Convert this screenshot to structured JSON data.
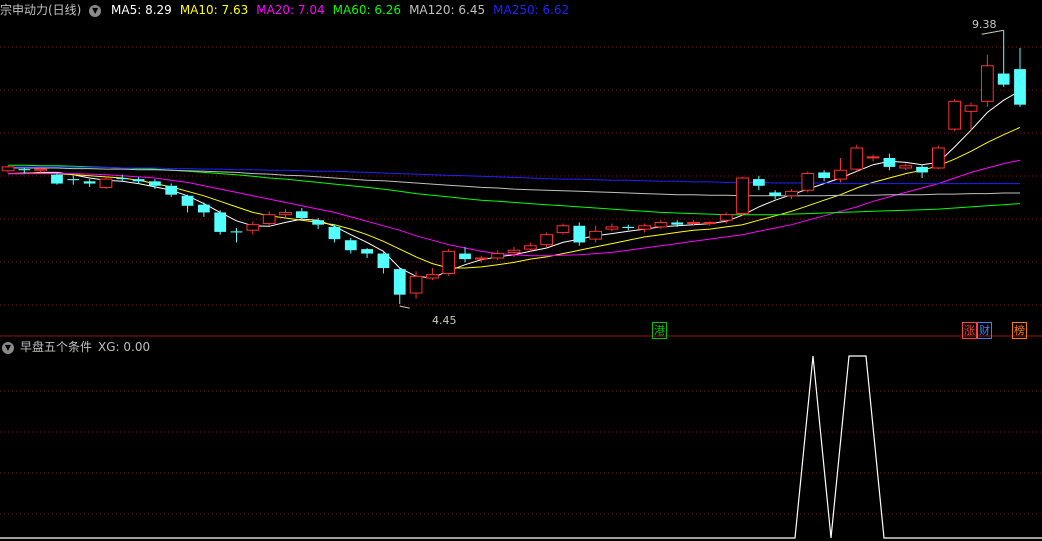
{
  "main_header": {
    "title": "宗申动力(日线)",
    "ma": [
      {
        "label": "MA5: ",
        "value": "8.29",
        "color": "#ffffff"
      },
      {
        "label": "MA10: ",
        "value": "7.63",
        "color": "#ffff00"
      },
      {
        "label": "MA20: ",
        "value": "7.04",
        "color": "#ff00ff"
      },
      {
        "label": "MA60: ",
        "value": "6.26",
        "color": "#00ff00"
      },
      {
        "label": "MA120: ",
        "value": "6.45",
        "color": "#c0c0c0"
      },
      {
        "label": "MA250: ",
        "value": "6.62",
        "color": "#2020ff"
      }
    ]
  },
  "sub_header": {
    "title": "早盘五个条件",
    "xg_label": "XG: ",
    "xg_value": "0.00"
  },
  "annotations": {
    "high": "9.38",
    "low": "4.45"
  },
  "tags": [
    {
      "text": "港",
      "color": "#00c000"
    },
    {
      "text": "涨",
      "color": "#ff4040"
    },
    {
      "text": "财",
      "color": "#4080ff"
    },
    {
      "text": "榜",
      "color": "#ff8000"
    }
  ],
  "chart_data": {
    "type": "candlestick",
    "ylim": [
      4.2,
      9.6
    ],
    "up_color": "#ff3030",
    "down_color": "#54ffff",
    "candles": [
      [
        6.85,
        6.92,
        6.94,
        6.82
      ],
      [
        6.88,
        6.86,
        6.9,
        6.8
      ],
      [
        6.86,
        6.88,
        6.9,
        6.82
      ],
      [
        6.78,
        6.62,
        6.8,
        6.6
      ],
      [
        6.7,
        6.68,
        6.76,
        6.6
      ],
      [
        6.66,
        6.62,
        6.7,
        6.56
      ],
      [
        6.55,
        6.7,
        6.74,
        6.52
      ],
      [
        6.72,
        6.7,
        6.78,
        6.66
      ],
      [
        6.7,
        6.66,
        6.74,
        6.62
      ],
      [
        6.66,
        6.58,
        6.7,
        6.52
      ],
      [
        6.58,
        6.42,
        6.62,
        6.38
      ],
      [
        6.4,
        6.22,
        6.42,
        6.1
      ],
      [
        6.24,
        6.1,
        6.28,
        6.02
      ],
      [
        6.1,
        5.75,
        6.14,
        5.7
      ],
      [
        5.76,
        5.74,
        5.82,
        5.56
      ],
      [
        5.78,
        5.88,
        5.94,
        5.7
      ],
      [
        5.9,
        6.06,
        6.12,
        5.86
      ],
      [
        6.06,
        6.1,
        6.16,
        6.0
      ],
      [
        6.12,
        6.0,
        6.18,
        5.96
      ],
      [
        5.96,
        5.88,
        6.0,
        5.8
      ],
      [
        5.84,
        5.62,
        5.88,
        5.56
      ],
      [
        5.6,
        5.42,
        5.64,
        5.36
      ],
      [
        5.44,
        5.36,
        5.46,
        5.28
      ],
      [
        5.36,
        5.1,
        5.38,
        5.0
      ],
      [
        5.08,
        4.62,
        5.1,
        4.45
      ],
      [
        4.65,
        4.95,
        5.04,
        4.55
      ],
      [
        4.92,
        4.98,
        5.1,
        4.88
      ],
      [
        5.0,
        5.4,
        5.44,
        4.96
      ],
      [
        5.36,
        5.26,
        5.48,
        5.2
      ],
      [
        5.26,
        5.28,
        5.32,
        5.2
      ],
      [
        5.28,
        5.36,
        5.42,
        5.24
      ],
      [
        5.38,
        5.42,
        5.48,
        5.3
      ],
      [
        5.44,
        5.5,
        5.56,
        5.4
      ],
      [
        5.52,
        5.7,
        5.74,
        5.48
      ],
      [
        5.74,
        5.86,
        5.9,
        5.7
      ],
      [
        5.86,
        5.56,
        5.92,
        5.5
      ],
      [
        5.62,
        5.76,
        5.86,
        5.56
      ],
      [
        5.8,
        5.84,
        5.9,
        5.76
      ],
      [
        5.84,
        5.82,
        5.88,
        5.78
      ],
      [
        5.8,
        5.86,
        5.9,
        5.74
      ],
      [
        5.84,
        5.92,
        5.96,
        5.8
      ],
      [
        5.92,
        5.88,
        5.96,
        5.84
      ],
      [
        5.9,
        5.92,
        5.96,
        5.86
      ],
      [
        5.9,
        5.92,
        5.94,
        5.86
      ],
      [
        5.96,
        6.06,
        6.1,
        5.9
      ],
      [
        6.08,
        6.72,
        6.74,
        6.04
      ],
      [
        6.7,
        6.58,
        6.76,
        6.5
      ],
      [
        6.46,
        6.4,
        6.5,
        6.34
      ],
      [
        6.4,
        6.48,
        6.52,
        6.34
      ],
      [
        6.5,
        6.8,
        6.84,
        6.46
      ],
      [
        6.82,
        6.72,
        6.86,
        6.66
      ],
      [
        6.7,
        6.86,
        7.08,
        6.64
      ],
      [
        6.88,
        7.26,
        7.32,
        6.84
      ],
      [
        7.1,
        7.1,
        7.14,
        7.02
      ],
      [
        7.08,
        6.92,
        7.16,
        6.86
      ],
      [
        6.9,
        6.94,
        6.98,
        6.86
      ],
      [
        6.92,
        6.82,
        6.96,
        6.72
      ],
      [
        6.9,
        7.26,
        7.3,
        6.88
      ],
      [
        7.6,
        8.1,
        8.14,
        7.56
      ],
      [
        7.92,
        8.02,
        8.08,
        7.58
      ],
      [
        8.1,
        8.74,
        8.94,
        8.0
      ],
      [
        8.6,
        8.4,
        9.38,
        8.36
      ],
      [
        8.68,
        8.04,
        9.06,
        8.0
      ]
    ],
    "ma_series": [
      {
        "name": "MA5",
        "color": "#ffffff",
        "values": [
          6.8,
          6.8,
          6.82,
          6.82,
          6.78,
          6.72,
          6.68,
          6.66,
          6.62,
          6.56,
          6.5,
          6.4,
          6.26,
          6.1,
          5.95,
          5.86,
          5.85,
          5.92,
          5.98,
          5.96,
          5.85,
          5.7,
          5.56,
          5.4,
          5.1,
          4.95,
          4.92,
          5.05,
          5.16,
          5.25,
          5.3,
          5.34,
          5.4,
          5.46,
          5.56,
          5.62,
          5.68,
          5.72,
          5.76,
          5.8,
          5.84,
          5.86,
          5.88,
          5.9,
          5.94,
          6.05,
          6.2,
          6.32,
          6.42,
          6.52,
          6.62,
          6.72,
          6.84,
          6.96,
          7.02,
          7.0,
          6.96,
          7.0,
          7.28,
          7.58,
          7.9,
          8.12,
          8.29
        ]
      },
      {
        "name": "MA10",
        "color": "#ffff00",
        "values": [
          6.8,
          6.81,
          6.81,
          6.8,
          6.78,
          6.76,
          6.74,
          6.72,
          6.68,
          6.62,
          6.56,
          6.48,
          6.4,
          6.3,
          6.2,
          6.1,
          6.04,
          6.0,
          5.96,
          5.92,
          5.88,
          5.8,
          5.7,
          5.58,
          5.44,
          5.3,
          5.18,
          5.1,
          5.1,
          5.12,
          5.16,
          5.2,
          5.26,
          5.3,
          5.36,
          5.42,
          5.48,
          5.54,
          5.6,
          5.66,
          5.7,
          5.74,
          5.78,
          5.8,
          5.84,
          5.88,
          5.96,
          6.04,
          6.12,
          6.22,
          6.32,
          6.42,
          6.54,
          6.64,
          6.72,
          6.8,
          6.86,
          6.94,
          7.06,
          7.2,
          7.36,
          7.5,
          7.63
        ]
      },
      {
        "name": "MA20",
        "color": "#ff00ff",
        "values": [
          6.8,
          6.8,
          6.8,
          6.8,
          6.8,
          6.79,
          6.78,
          6.76,
          6.74,
          6.72,
          6.68,
          6.64,
          6.58,
          6.52,
          6.46,
          6.4,
          6.34,
          6.28,
          6.22,
          6.16,
          6.1,
          6.02,
          5.94,
          5.86,
          5.78,
          5.68,
          5.6,
          5.52,
          5.46,
          5.4,
          5.36,
          5.34,
          5.32,
          5.32,
          5.33,
          5.34,
          5.36,
          5.38,
          5.42,
          5.46,
          5.5,
          5.54,
          5.58,
          5.62,
          5.66,
          5.7,
          5.76,
          5.82,
          5.88,
          5.96,
          6.04,
          6.12,
          6.2,
          6.3,
          6.38,
          6.46,
          6.54,
          6.62,
          6.72,
          6.82,
          6.9,
          6.98,
          7.04
        ]
      },
      {
        "name": "MA60",
        "color": "#00ff00",
        "values": [
          6.95,
          6.95,
          6.94,
          6.94,
          6.93,
          6.92,
          6.91,
          6.9,
          6.89,
          6.88,
          6.86,
          6.84,
          6.82,
          6.8,
          6.78,
          6.75,
          6.72,
          6.7,
          6.67,
          6.64,
          6.61,
          6.58,
          6.55,
          6.52,
          6.48,
          6.44,
          6.41,
          6.38,
          6.35,
          6.32,
          6.3,
          6.28,
          6.26,
          6.24,
          6.22,
          6.2,
          6.18,
          6.16,
          6.14,
          6.12,
          6.1,
          6.09,
          6.08,
          6.07,
          6.06,
          6.06,
          6.06,
          6.06,
          6.07,
          6.08,
          6.09,
          6.1,
          6.11,
          6.12,
          6.13,
          6.14,
          6.15,
          6.16,
          6.18,
          6.2,
          6.22,
          6.24,
          6.26
        ]
      },
      {
        "name": "MA120",
        "color": "#c0c0c0",
        "values": [
          6.9,
          6.9,
          6.9,
          6.9,
          6.89,
          6.89,
          6.88,
          6.88,
          6.87,
          6.87,
          6.86,
          6.85,
          6.84,
          6.83,
          6.82,
          6.8,
          6.79,
          6.77,
          6.76,
          6.74,
          6.72,
          6.7,
          6.68,
          6.67,
          6.65,
          6.63,
          6.61,
          6.59,
          6.57,
          6.55,
          6.54,
          6.52,
          6.51,
          6.5,
          6.49,
          6.48,
          6.47,
          6.46,
          6.45,
          6.44,
          6.43,
          6.42,
          6.42,
          6.41,
          6.41,
          6.4,
          6.4,
          6.4,
          6.4,
          6.4,
          6.4,
          6.41,
          6.41,
          6.41,
          6.42,
          6.42,
          6.42,
          6.43,
          6.43,
          6.44,
          6.44,
          6.45,
          6.45
        ]
      },
      {
        "name": "MA250",
        "color": "#2020ff",
        "values": [
          6.92,
          6.92,
          6.92,
          6.92,
          6.91,
          6.91,
          6.91,
          6.9,
          6.9,
          6.9,
          6.89,
          6.89,
          6.88,
          6.88,
          6.87,
          6.87,
          6.86,
          6.86,
          6.85,
          6.84,
          6.84,
          6.83,
          6.82,
          6.81,
          6.8,
          6.79,
          6.78,
          6.77,
          6.76,
          6.75,
          6.74,
          6.73,
          6.72,
          6.71,
          6.7,
          6.7,
          6.69,
          6.68,
          6.68,
          6.67,
          6.66,
          6.66,
          6.65,
          6.65,
          6.64,
          6.64,
          6.64,
          6.63,
          6.63,
          6.63,
          6.63,
          6.62,
          6.62,
          6.62,
          6.62,
          6.62,
          6.62,
          6.62,
          6.62,
          6.62,
          6.62,
          6.62,
          6.62
        ]
      }
    ],
    "xg": {
      "name": "XG",
      "color": "#ffffff",
      "values": [
        0,
        1,
        0,
        1,
        1,
        0
      ]
    }
  }
}
